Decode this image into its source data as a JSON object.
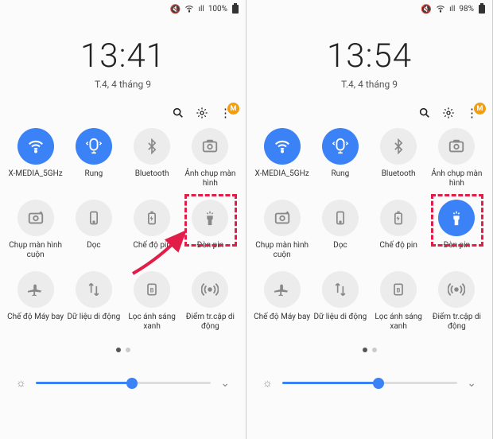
{
  "left": {
    "status": {
      "signal": "ıll",
      "pct": "100%"
    },
    "clock": "13:41",
    "date": "T.4, 4 tháng 9",
    "avatar_letter": "M",
    "tiles": [
      {
        "label": "X-MEDIA_5GHz",
        "icon": "wifi",
        "active": true
      },
      {
        "label": "Rung",
        "icon": "vibrate",
        "active": true
      },
      {
        "label": "Bluetooth",
        "icon": "bt",
        "active": false
      },
      {
        "label": "Ảnh chụp màn hình",
        "icon": "screenshot",
        "active": false
      },
      {
        "label": "Chụp màn hình cuộn",
        "icon": "scroll",
        "active": false
      },
      {
        "label": "Dọc",
        "icon": "portrait",
        "active": false
      },
      {
        "label": "Chế độ pin",
        "icon": "battmode",
        "active": false
      },
      {
        "label": "Đèn pin",
        "icon": "torch",
        "active": false
      },
      {
        "label": "Chế độ Máy bay",
        "icon": "plane",
        "active": false
      },
      {
        "label": "Dữ liệu di động",
        "icon": "data",
        "active": false
      },
      {
        "label": "Lọc ánh sáng xanh",
        "icon": "blue",
        "active": false
      },
      {
        "label": "Điểm tr.cập di động",
        "icon": "hotspot",
        "active": false
      }
    ],
    "brightness_pct": 55,
    "highlight_tile": 7,
    "arrow": true,
    "torch_on": false
  },
  "right": {
    "status": {
      "signal": "ıll",
      "pct": "98%"
    },
    "clock": "13:54",
    "date": "T.4, 4 tháng 9",
    "avatar_letter": "M",
    "tiles": [
      {
        "label": "X-MEDIA_5GHz",
        "icon": "wifi",
        "active": true
      },
      {
        "label": "Rung",
        "icon": "vibrate",
        "active": true
      },
      {
        "label": "Bluetooth",
        "icon": "bt",
        "active": false
      },
      {
        "label": "Ảnh chụp màn hình",
        "icon": "screenshot",
        "active": false
      },
      {
        "label": "Chụp màn hình cuộn",
        "icon": "scroll",
        "active": false
      },
      {
        "label": "Dọc",
        "icon": "portrait",
        "active": false
      },
      {
        "label": "Chế độ pin",
        "icon": "battmode",
        "active": false
      },
      {
        "label": "Đèn pin",
        "icon": "torch",
        "active": true
      },
      {
        "label": "Chế độ Máy bay",
        "icon": "plane",
        "active": false
      },
      {
        "label": "Dữ liệu di động",
        "icon": "data",
        "active": false
      },
      {
        "label": "Lọc ánh sáng xanh",
        "icon": "blue",
        "active": false
      },
      {
        "label": "Điểm tr.cập di động",
        "icon": "hotspot",
        "active": false
      }
    ],
    "brightness_pct": 55,
    "highlight_tile": 7,
    "arrow": false,
    "torch_on": true
  }
}
